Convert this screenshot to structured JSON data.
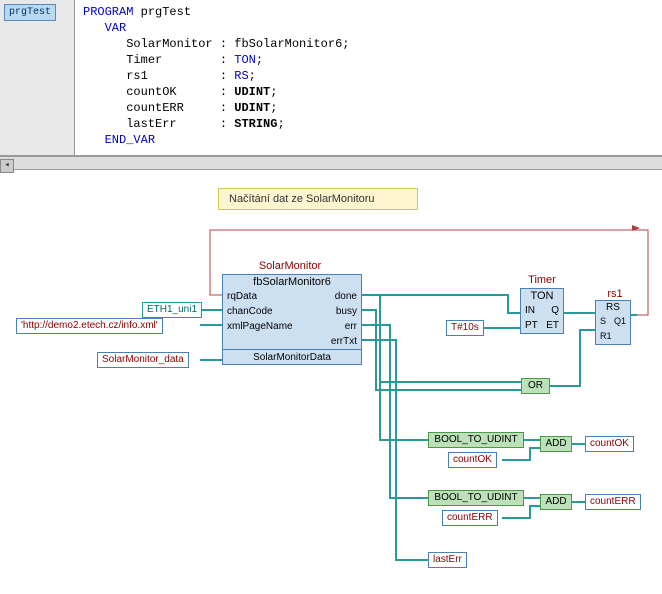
{
  "tree": {
    "root": "prgTest"
  },
  "code": {
    "line1_kw": "PROGRAM",
    "line1_id": "prgTest",
    "line2_kw": "VAR",
    "var1_name": "SolarMonitor",
    "var1_type": "fbSolarMonitor6",
    "var2_name": "Timer",
    "var2_type": "TON",
    "var3_name": "rs1",
    "var3_type": "RS",
    "var4_name": "countOK",
    "var4_type": "UDINT",
    "var5_name": "countERR",
    "var5_type": "UDINT",
    "var6_name": "lastErr",
    "var6_type": "STRING",
    "endvar_kw": "END_VAR"
  },
  "diagram": {
    "comment": "Načítání dat ze SolarMonitoru",
    "solarMonitor": {
      "instance": "SolarMonitor",
      "type": "fbSolarMonitor6",
      "in_rqData": "rqData",
      "out_done": "done",
      "in_chanCode": "chanCode",
      "out_busy": "busy",
      "in_xmlPageName": "xmlPageName",
      "out_err": "err",
      "out_errTxt": "errTxt",
      "io_data": "SolarMonitorData"
    },
    "timer": {
      "instance": "Timer",
      "type": "TON",
      "in1": "IN",
      "out1": "Q",
      "in2": "PT",
      "out2": "ET"
    },
    "rs1": {
      "instance": "rs1",
      "type": "RS",
      "in1": "S",
      "out1": "Q1",
      "in2": "R1"
    },
    "labels": {
      "eth1": "ETH1_uni1",
      "url": "'http://demo2.etech.cz/info.xml'",
      "sm_data": "SolarMonitor_data",
      "t10s": "T#10s",
      "or": "OR",
      "b2u1": "BOOL_TO_UDINT",
      "add1": "ADD",
      "countOK_in": "countOK",
      "countOK_out": "countOK",
      "b2u2": "BOOL_TO_UDINT",
      "add2": "ADD",
      "countERR_in": "countERR",
      "countERR_out": "countERR",
      "lastErr": "lastErr"
    }
  }
}
